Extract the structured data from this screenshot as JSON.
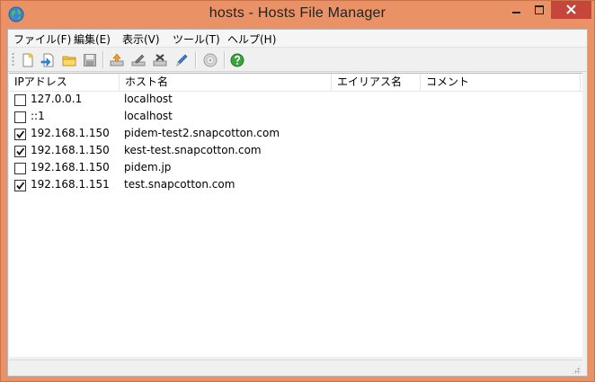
{
  "window": {
    "title": "hosts  - Hosts File Manager"
  },
  "menu": [
    {
      "label": "ファイル(F)"
    },
    {
      "label": "編集(E)"
    },
    {
      "label": "表示(V)"
    },
    {
      "label": "ツール(T)"
    },
    {
      "label": "ヘルプ(H)"
    }
  ],
  "toolbar": {
    "buttons": [
      "new-file-icon",
      "import-icon",
      "open-folder-icon",
      "save-icon",
      "add-entry-icon",
      "edit-entry-icon",
      "delete-entry-icon",
      "pen-icon",
      "settings-disc-icon",
      "help-icon"
    ]
  },
  "columns": [
    "IPアドレス",
    "ホスト名",
    "エイリアス名",
    "コメント"
  ],
  "rows": [
    {
      "checked": false,
      "ip": "127.0.0.1",
      "host": "localhost"
    },
    {
      "checked": false,
      "ip": "::1",
      "host": "localhost"
    },
    {
      "checked": true,
      "ip": "192.168.1.150",
      "host": "pidem-test2.snapcotton.com"
    },
    {
      "checked": true,
      "ip": "192.168.1.150",
      "host": "kest-test.snapcotton.com"
    },
    {
      "checked": false,
      "ip": "192.168.1.150",
      "host": "pidem.jp"
    },
    {
      "checked": true,
      "ip": "192.168.1.151",
      "host": "test.snapcotton.com"
    }
  ],
  "colors": {
    "frame": "#ea9266",
    "close": "#c7463b"
  }
}
